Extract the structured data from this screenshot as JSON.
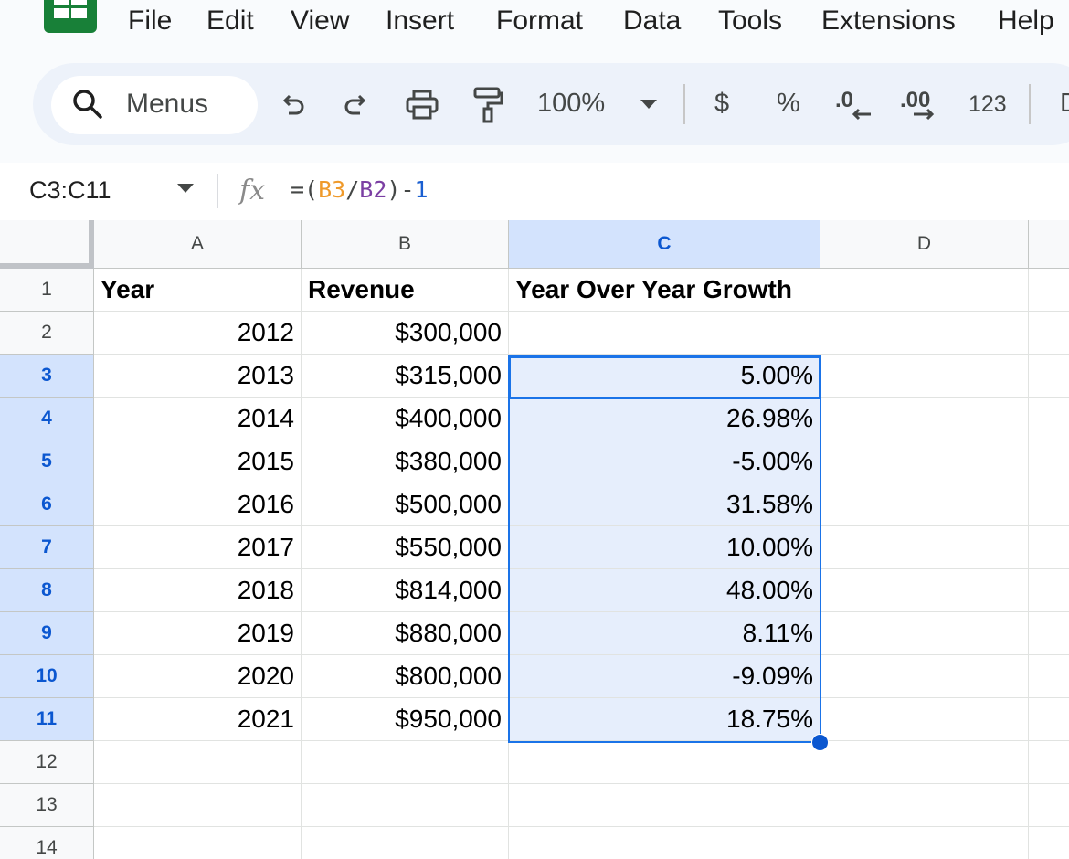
{
  "menubar": {
    "items": [
      "File",
      "Edit",
      "View",
      "Insert",
      "Format",
      "Data",
      "Tools",
      "Extensions",
      "Help"
    ]
  },
  "toolbar": {
    "search_label": "Menus",
    "zoom": "100%",
    "currency_label": "$",
    "percent_label": "%",
    "more_formats_label": "123",
    "truncated_label": "D"
  },
  "formula_bar": {
    "name_box": "C3:C11",
    "fx_label": "fx",
    "formula": {
      "prefix": "=(",
      "ref1": "B3",
      "slash": "/",
      "ref2": "B2",
      "suffix": ")-",
      "number": "1"
    }
  },
  "sheet": {
    "columns": [
      "A",
      "B",
      "C",
      "D"
    ],
    "selected_column": "C",
    "selected_rows": [
      3,
      4,
      5,
      6,
      7,
      8,
      9,
      10,
      11
    ],
    "row_numbers": [
      "1",
      "2",
      "3",
      "4",
      "5",
      "6",
      "7",
      "8",
      "9",
      "10",
      "11",
      "12",
      "13",
      "14"
    ],
    "headers": [
      "Year",
      "Revenue",
      "Year Over Year Growth"
    ],
    "rows": [
      [
        "2012",
        "$300,000",
        ""
      ],
      [
        "2013",
        "$315,000",
        "5.00%"
      ],
      [
        "2014",
        "$400,000",
        "26.98%"
      ],
      [
        "2015",
        "$380,000",
        "-5.00%"
      ],
      [
        "2016",
        "$500,000",
        "31.58%"
      ],
      [
        "2017",
        "$550,000",
        "10.00%"
      ],
      [
        "2018",
        "$814,000",
        "48.00%"
      ],
      [
        "2019",
        "$880,000",
        "8.11%"
      ],
      [
        "2020",
        "$800,000",
        "-9.09%"
      ],
      [
        "2021",
        "$950,000",
        "18.75%"
      ]
    ]
  },
  "colors": {
    "selection_border": "#1a73e8",
    "selection_fill": "#e6eefc",
    "header_selected": "#d3e3fd",
    "brand_green": "#188038"
  }
}
